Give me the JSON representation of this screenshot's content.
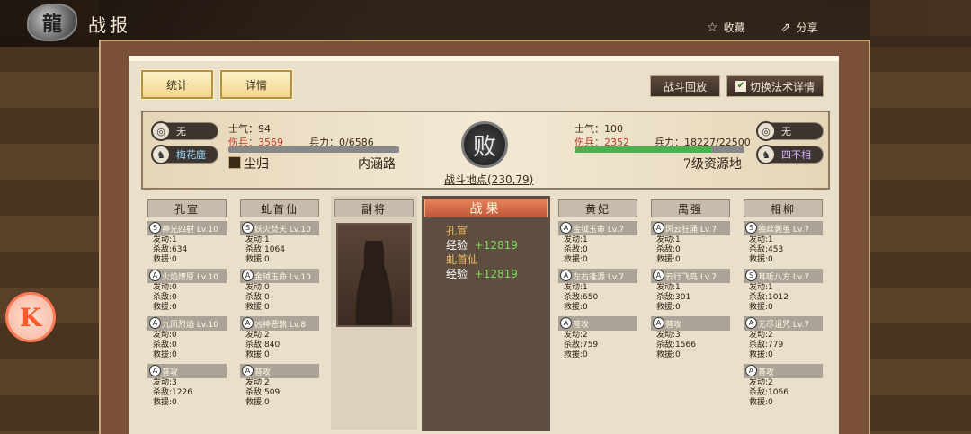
{
  "header": {
    "title": "战报",
    "favorite_label": "收藏",
    "share_label": "分享"
  },
  "tabs": {
    "stats": "统计",
    "details": "详情"
  },
  "actions": {
    "replay": "战斗回放",
    "toggle_skill": "切换法术详情"
  },
  "left_side": {
    "badge1": "无",
    "badge2": "梅花鹿",
    "morale": "士气：94",
    "injured_label": "伤兵：",
    "injured": "3569",
    "troops": "兵力：0/6586",
    "troop_fraction": 0,
    "player": "尘归",
    "location": "内涵路"
  },
  "right_side": {
    "badge1": "无",
    "badge2": "四不相",
    "morale": "士气：100",
    "injured_label": "伤兵：",
    "injured": "2352",
    "troops": "兵力：18227/22500",
    "troop_fraction": 0.81,
    "player": "",
    "location": "7级资源地"
  },
  "result_badge": "败",
  "battle_location": "战斗地点(230,79)",
  "results": {
    "header": "战果",
    "entries": [
      {
        "name": "孔宣",
        "exp_label": "经验",
        "exp": "+12819"
      },
      {
        "name": "虬首仙",
        "exp_label": "经验",
        "exp": "+12819"
      }
    ]
  },
  "deputy": {
    "header": "副将"
  },
  "columns": [
    {
      "name": "孔宣",
      "skills": [
        {
          "icon": "S",
          "label": "神光四射 Lv.10",
          "stats": [
            "发动:1",
            "杀敌:634",
            "救援:0"
          ]
        },
        {
          "icon": "A",
          "label": "火焰燎原 Lv.10",
          "stats": [
            "发动:0",
            "杀敌:0",
            "救援:0"
          ]
        },
        {
          "icon": "A",
          "label": "九凤烈焰 Lv.10",
          "stats": [
            "发动:0",
            "杀敌:0",
            "救援:0"
          ]
        },
        {
          "icon": "A",
          "label": "普攻",
          "stats": [
            "发动:3",
            "杀敌:1226",
            "救援:0"
          ]
        }
      ]
    },
    {
      "name": "虬首仙",
      "skills": [
        {
          "icon": "S",
          "label": "妖火焚天 Lv.10",
          "stats": [
            "发动:1",
            "杀敌:1064",
            "救援:0"
          ]
        },
        {
          "icon": "A",
          "label": "金钺玉命 Lv.10",
          "stats": [
            "发动:0",
            "杀敌:0",
            "救援:0"
          ]
        },
        {
          "icon": "A",
          "label": "凶神恶煞 Lv.8",
          "stats": [
            "发动:2",
            "杀敌:840",
            "救援:0"
          ]
        },
        {
          "icon": "A",
          "label": "普攻",
          "stats": [
            "发动:2",
            "杀敌:509",
            "救援:0"
          ]
        }
      ]
    },
    {
      "name": "黄妃",
      "skills": [
        {
          "icon": "A",
          "label": "金钺玉命 Lv.7",
          "stats": [
            "发动:1",
            "杀敌:0",
            "救援:0"
          ]
        },
        {
          "icon": "A",
          "label": "左右逢源 Lv.7",
          "stats": [
            "发动:1",
            "杀敌:650",
            "救援:0"
          ]
        },
        {
          "icon": "A",
          "label": "普攻",
          "stats": [
            "发动:2",
            "杀敌:759",
            "救援:0"
          ]
        }
      ]
    },
    {
      "name": "禺强",
      "skills": [
        {
          "icon": "A",
          "label": "风云狂涌 Lv.7",
          "stats": [
            "发动:1",
            "杀敌:0",
            "救援:0"
          ]
        },
        {
          "icon": "A",
          "label": "云行飞鸟 Lv.7",
          "stats": [
            "发动:1",
            "杀敌:301",
            "救援:0"
          ]
        },
        {
          "icon": "A",
          "label": "普攻",
          "stats": [
            "发动:3",
            "杀敌:1566",
            "救援:0"
          ]
        }
      ]
    },
    {
      "name": "相柳",
      "skills": [
        {
          "icon": "S",
          "label": "抽丝剥茧 Lv.7",
          "stats": [
            "发动:1",
            "杀敌:453",
            "救援:0"
          ]
        },
        {
          "icon": "S",
          "label": "耳听八方 Lv.7",
          "stats": [
            "发动:1",
            "杀敌:1012",
            "救援:0"
          ]
        },
        {
          "icon": "A",
          "label": "无尽诅咒 Lv.7",
          "stats": [
            "发动:2",
            "杀敌:779",
            "救援:0"
          ]
        },
        {
          "icon": "A",
          "label": "普攻",
          "stats": [
            "发动:2",
            "杀敌:1066",
            "救援:0"
          ]
        }
      ]
    }
  ],
  "side_button": "K"
}
